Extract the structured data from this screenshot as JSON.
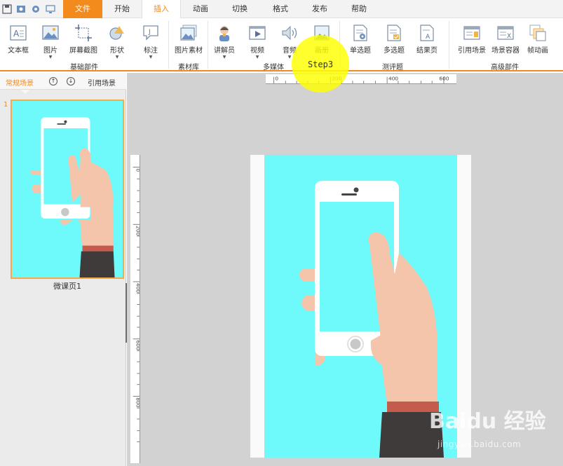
{
  "tabs": [
    {
      "label": "文件",
      "kind": "file"
    },
    {
      "label": "开始",
      "kind": "normal"
    },
    {
      "label": "插入",
      "kind": "active"
    },
    {
      "label": "动画",
      "kind": "normal"
    },
    {
      "label": "切换",
      "kind": "normal"
    },
    {
      "label": "格式",
      "kind": "normal"
    },
    {
      "label": "发布",
      "kind": "normal"
    },
    {
      "label": "帮助",
      "kind": "normal"
    }
  ],
  "ribbon": {
    "basic": {
      "group_label": "基础部件",
      "textbox": "文本框",
      "image": "图片",
      "screenshot": "屏幕截图",
      "shape": "形状",
      "callout": "标注"
    },
    "library": {
      "group_label": "素材库",
      "image_material": "图片素材"
    },
    "media": {
      "group_label": "多媒体",
      "narrator": "讲解员",
      "video": "视频",
      "audio": "音频",
      "album": "画册"
    },
    "quiz": {
      "group_label": "测评题",
      "single_choice": "单选题",
      "multi_choice": "多选题",
      "result_page": "结果页"
    },
    "advanced": {
      "group_label": "高级部件",
      "ref_scene": "引用场景",
      "scene_container": "场景容器",
      "frame_anim": "帧动画"
    }
  },
  "left_panel": {
    "tab_regular": "常规场景",
    "tab_reference": "引用场景",
    "up_symbol": "↑",
    "down_symbol": "↓",
    "slide_number": "1",
    "slide_label": "微课页1"
  },
  "rulers": {
    "h_labels": [
      "0",
      "200",
      "400",
      "600"
    ],
    "v_labels": [
      "0",
      "200",
      "400",
      "600",
      "800"
    ]
  },
  "annotation": {
    "step_label": "Step3"
  },
  "watermark": {
    "brand": "Baidu 经验",
    "url": "jingyan.baidu.com"
  },
  "colors": {
    "accent": "#f28a1c",
    "canvas_bg": "#6ef9fb",
    "step": "#ffff00"
  }
}
